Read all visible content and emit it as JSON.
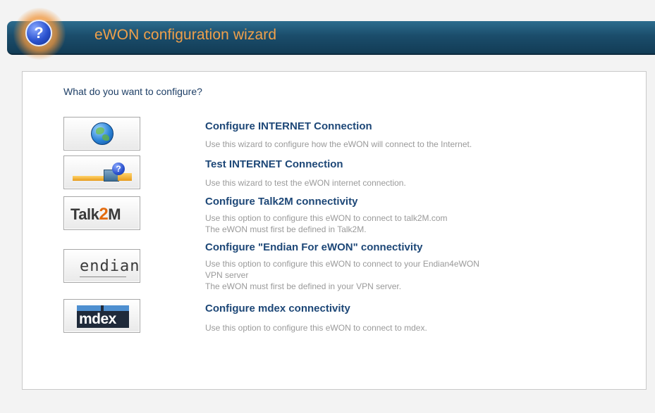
{
  "header": {
    "title": "eWON configuration wizard",
    "help_icon_glyph": "?"
  },
  "panel": {
    "question": "What do you want to configure?",
    "options": [
      {
        "title": "Configure INTERNET Connection",
        "desc": [
          "Use this wizard to configure how the eWON will connect to the Internet."
        ],
        "icon": "globe-icon"
      },
      {
        "title": "Test INTERNET Connection",
        "desc": [
          "Use this wizard to test the eWON internet connection."
        ],
        "icon": "connection-test-icon",
        "icon_glyph": "?"
      },
      {
        "title": "Configure Talk2M connectivity",
        "desc": [
          "Use this option to configure this eWON to connect to talk2M.com",
          "The eWON must first be defined in Talk2M."
        ],
        "icon": "talk2m-logo",
        "logo_text_a": "Talk",
        "logo_text_b": "2",
        "logo_text_c": "M"
      },
      {
        "title": "Configure \"Endian For eWON\" connectivity",
        "desc": [
          "Use this option to configure this eWON to connect to your Endian4eWON",
          "VPN server",
          "The eWON must first be defined in your VPN server."
        ],
        "icon": "endian-logo",
        "logo_text": "endian"
      },
      {
        "title": "Configure mdex connectivity",
        "desc": [
          "Use this option to configure this eWON to connect to mdex."
        ],
        "icon": "mdex-logo",
        "logo_text": "mdex"
      }
    ]
  },
  "colors": {
    "header_bg": "#1b4d6b",
    "header_title": "#f0a04a",
    "option_title": "#1d4777",
    "option_desc": "#9a9a9a"
  }
}
